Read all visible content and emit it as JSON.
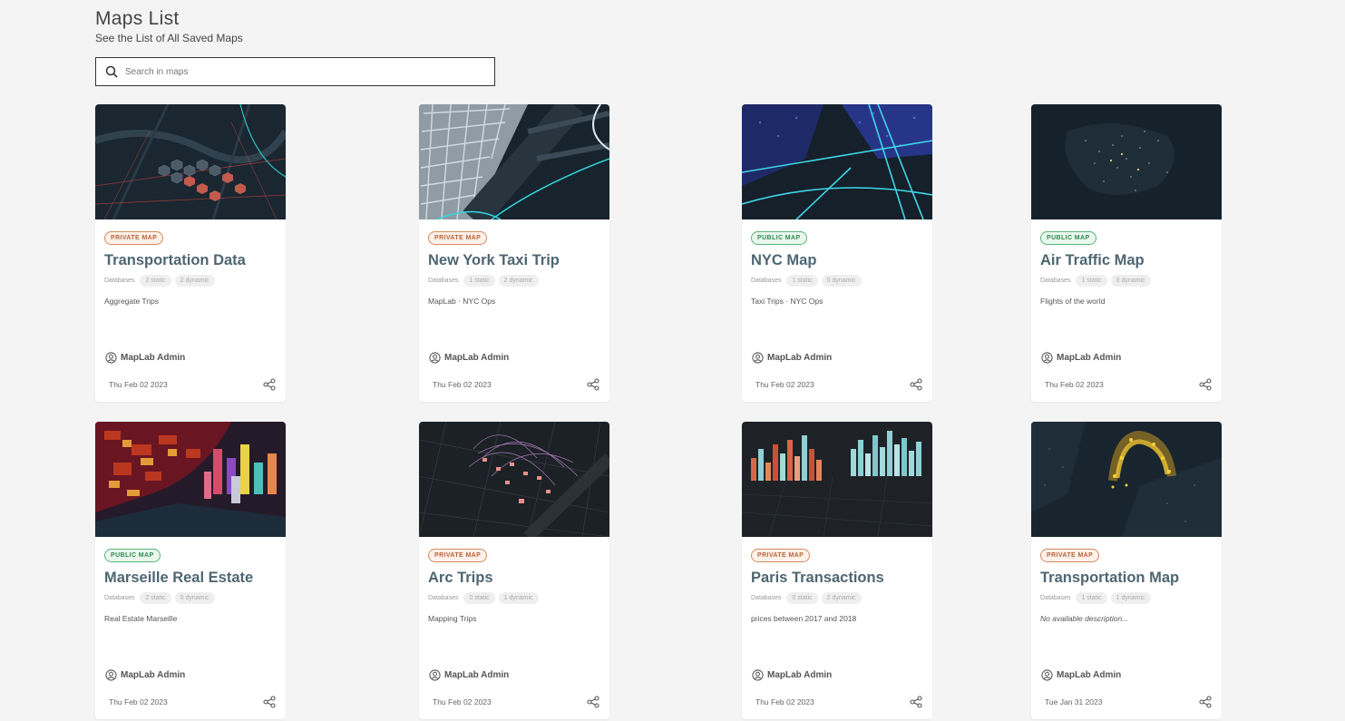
{
  "header": {
    "title": "Maps List",
    "subtitle": "See the List of All Saved Maps"
  },
  "search": {
    "placeholder": "Search in maps",
    "value": ""
  },
  "maps": [
    {
      "badge": "PRIVATE MAP",
      "title": "Transportation Data",
      "db_label": "Databases",
      "static": "2 static",
      "dynamic": "2 dynamic",
      "description": "Aggregate Trips",
      "owner": "MapLab Admin",
      "date": "Thu Feb 02 2023"
    },
    {
      "badge": "PRIVATE MAP",
      "title": "New York Taxi Trip",
      "db_label": "Databases",
      "static": "1 static",
      "dynamic": "2 dynamic",
      "description": "MapLab · NYC Ops",
      "owner": "MapLab Admin",
      "date": "Thu Feb 02 2023"
    },
    {
      "badge": "PUBLIC MAP",
      "title": "NYC Map",
      "db_label": "Databases",
      "static": "1 static",
      "dynamic": "0 dynamic",
      "description": "Taxi Trips · NYC Ops",
      "owner": "MapLab Admin",
      "date": "Thu Feb 02 2023"
    },
    {
      "badge": "PUBLIC MAP",
      "title": "Air Traffic Map",
      "db_label": "Databases",
      "static": "1 static",
      "dynamic": "0 dynamic",
      "description": "Flights of the world",
      "owner": "MapLab Admin",
      "date": "Thu Feb 02 2023"
    },
    {
      "badge": "PUBLIC MAP",
      "title": "Marseille Real Estate",
      "db_label": "Databases",
      "static": "2 static",
      "dynamic": "0 dynamic",
      "description": "Real Estate Marseille",
      "owner": "MapLab Admin",
      "date": "Thu Feb 02 2023"
    },
    {
      "badge": "PRIVATE MAP",
      "title": "Arc Trips",
      "db_label": "Databases",
      "static": "0 static",
      "dynamic": "1 dynamic",
      "description": "Mapping Trips",
      "owner": "MapLab Admin",
      "date": "Thu Feb 02 2023"
    },
    {
      "badge": "PRIVATE MAP",
      "title": "Paris Transactions",
      "db_label": "Databases",
      "static": "0 static",
      "dynamic": "2 dynamic",
      "description": "prices between 2017 and 2018",
      "owner": "MapLab Admin",
      "date": "Thu Feb 02 2023"
    },
    {
      "badge": "PRIVATE MAP",
      "title": "Transportation Map",
      "db_label": "Databases",
      "static": "1 static",
      "dynamic": "1 dynamic",
      "description": "No available description...",
      "owner": "MapLab Admin",
      "date": "Tue Jan 31 2023"
    }
  ],
  "colors": {
    "private_badge": "#b5643a",
    "public_badge": "#2f8a4e",
    "card_title": "#4e6672",
    "map_bg": "#1b2731"
  },
  "icons": {
    "search": "search-icon",
    "owner": "user-circle-icon",
    "share": "share-icon"
  }
}
